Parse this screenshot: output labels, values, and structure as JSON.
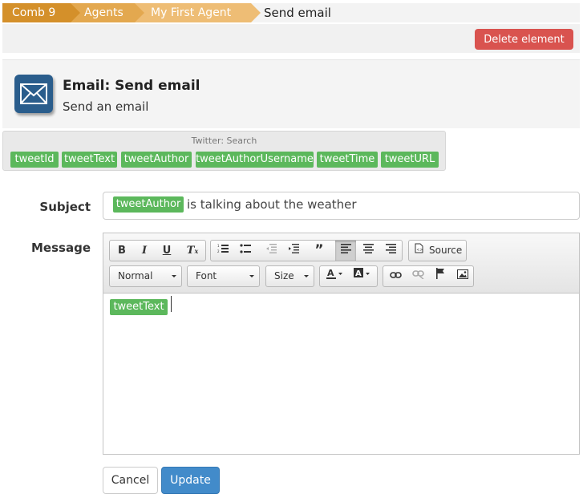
{
  "breadcrumb": {
    "items": [
      "Comb 9",
      "Agents",
      "My First Agent"
    ],
    "current": "Send email"
  },
  "actions": {
    "delete_label": "Delete element"
  },
  "header": {
    "icon": "envelope-icon",
    "title": "Email: Send email",
    "subtitle": "Send an email"
  },
  "variables": {
    "source": "Twitter: Search",
    "tags": [
      "tweetId",
      "tweetText",
      "tweetAuthor",
      "tweetAuthorUsername",
      "tweetTime",
      "tweetURL"
    ]
  },
  "form": {
    "subject_label": "Subject",
    "subject_tag": "tweetAuthor",
    "subject_text": "is talking about the weather",
    "message_label": "Message",
    "message_tag": "tweetText"
  },
  "editor_toolbar": {
    "format_select": "Normal",
    "font_select": "Font",
    "size_select": "Size",
    "source_label": "Source"
  },
  "buttons": {
    "cancel": "Cancel",
    "update": "Update"
  },
  "colors": {
    "tag_green": "#5cb85c",
    "delete_red": "#d9534f",
    "update_blue": "#428bca",
    "crumb_orange": "#d4902a"
  }
}
